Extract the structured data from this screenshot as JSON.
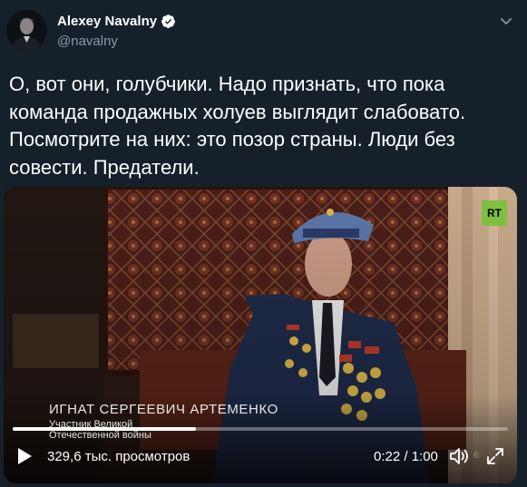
{
  "author": {
    "name": "Alexey Navalny",
    "handle": "@navalny",
    "verified": true,
    "avatar_icon": "person-avatar-icon"
  },
  "tweet": {
    "text": "О, вот они, голубчики. Надо признать, что пока\nкоманда продажных холуев выглядит слабовато.\nПосмотрите на них: это позор страны. Люди без\nсовести. Предатели."
  },
  "video": {
    "channel_logo": "RT",
    "caption_name": "ИГНАТ СЕРГЕЕВИЧ АРТЕМЕНКО",
    "caption_subtitle": "Участник Великой\nОтечественной войны",
    "views": "329,6 тыс. просмотров",
    "time": "0:22 / 1:00",
    "progress": 0.37,
    "speed_label": "6:"
  },
  "colors": {
    "background": "#15202b",
    "text": "#ffffff",
    "muted": "#8899a6",
    "verified": "#ffffff",
    "rt_green": "#7fbf3f"
  }
}
